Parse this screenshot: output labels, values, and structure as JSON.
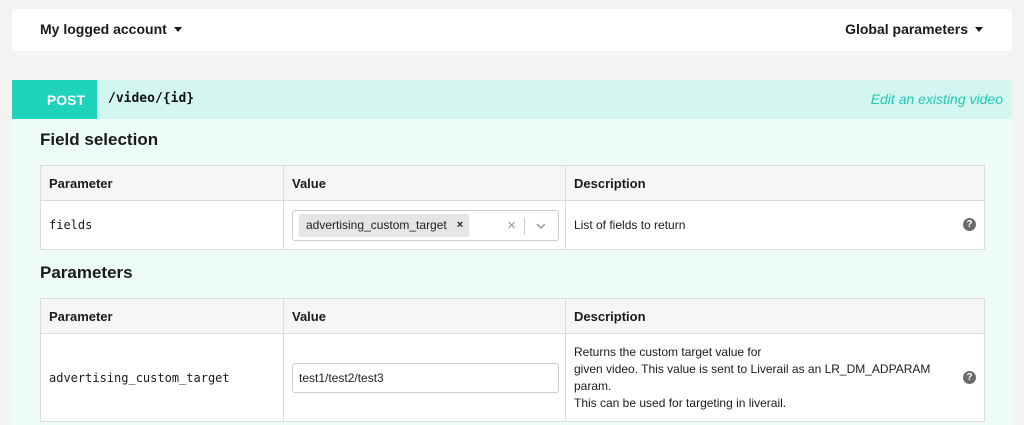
{
  "header": {
    "account_menu": "My logged account",
    "global_menu": "Global parameters"
  },
  "operation": {
    "method": "POST",
    "path": "/video/{id}",
    "summary": "Edit an existing video"
  },
  "field_selection": {
    "title": "Field selection",
    "columns": [
      "Parameter",
      "Value",
      "Description"
    ],
    "row": {
      "name": "fields",
      "selected_tag": "advertising_custom_target",
      "tag_remove": "×",
      "clear": "×",
      "description": "List of fields to return",
      "help": "?"
    }
  },
  "parameters": {
    "title": "Parameters",
    "columns": [
      "Parameter",
      "Value",
      "Description"
    ],
    "row": {
      "name": "advertising_custom_target",
      "value": "test1/test2/test3",
      "description_lines": [
        "Returns the custom target value for",
        "given video. This value is sent to Liverail as an LR_DM_ADPARAM",
        "param.",
        "This can be used for targeting in liverail."
      ],
      "help": "?"
    }
  },
  "icons": {
    "caret": "caret-down-icon",
    "chevron": "chevron-down-icon",
    "help": "help-icon"
  },
  "colors": {
    "accent": "#20d3bc",
    "summary": "#20c9b3",
    "panel_bg": "#eefcf9",
    "opbar_bg": "#d3f6f0"
  }
}
